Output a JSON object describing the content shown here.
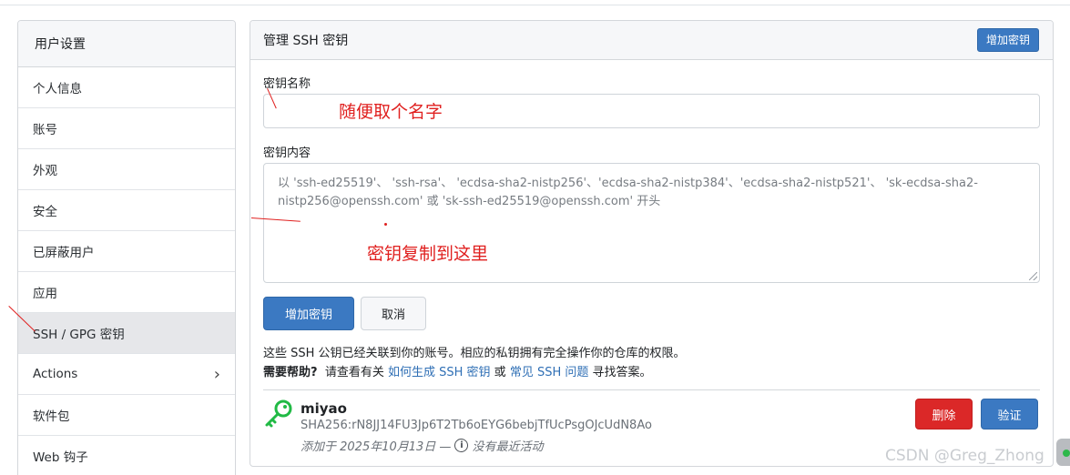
{
  "sidebar": {
    "header": "用户设置",
    "items": [
      {
        "label": "个人信息"
      },
      {
        "label": "账号"
      },
      {
        "label": "外观"
      },
      {
        "label": "安全"
      },
      {
        "label": "已屏蔽用户"
      },
      {
        "label": "应用"
      },
      {
        "label": "SSH / GPG 密钥",
        "active": true
      },
      {
        "label": "Actions",
        "chevron": "›"
      },
      {
        "label": "软件包"
      },
      {
        "label": "Web 钩子"
      }
    ]
  },
  "panel": {
    "title": "管理 SSH 密钥",
    "add_key_button": "增加密钥",
    "key_name_label": "密钥名称",
    "key_content_label": "密钥内容",
    "key_content_placeholder": "以 'ssh-ed25519'、 'ssh-rsa'、 'ecdsa-sha2-nistp256'、'ecdsa-sha2-nistp384'、'ecdsa-sha2-nistp521'、 'sk-ecdsa-sha2-nistp256@openssh.com' 或 'sk-ssh-ed25519@openssh.com' 开头",
    "submit_button": "增加密钥",
    "cancel_button": "取消",
    "info_line": "这些 SSH 公钥已经关联到你的账号。相应的私钥拥有完全操作你的仓库的权限。",
    "help_bold": "需要帮助?",
    "help_prefix": "请查看有关",
    "help_link1": "如何生成 SSH 密钥",
    "help_or": "或",
    "help_link2": "常见 SSH 问题",
    "help_suffix": "寻找答案。"
  },
  "key_entry": {
    "icon": "key-icon",
    "name": "miyao",
    "fingerprint": "SHA256:rN8JJ14FU3Jp6T2Tb6oEYG6bebjTfUcPsgOJcUdN8Ao",
    "meta_prefix": "添加于 2025年10月13日 —",
    "meta_suffix": "没有最近活动",
    "delete_button": "删除",
    "verify_button": "验证"
  },
  "annotations": {
    "name_hint": "随便取个名字",
    "content_hint": "密钥复制到这里"
  },
  "watermark": "CSDN @Greg_Zhong",
  "colors": {
    "primary": "#3b79c2",
    "danger": "#db2828",
    "key_icon": "#21ba45",
    "annotation": "#e0201f",
    "link": "#2f6fb5"
  }
}
